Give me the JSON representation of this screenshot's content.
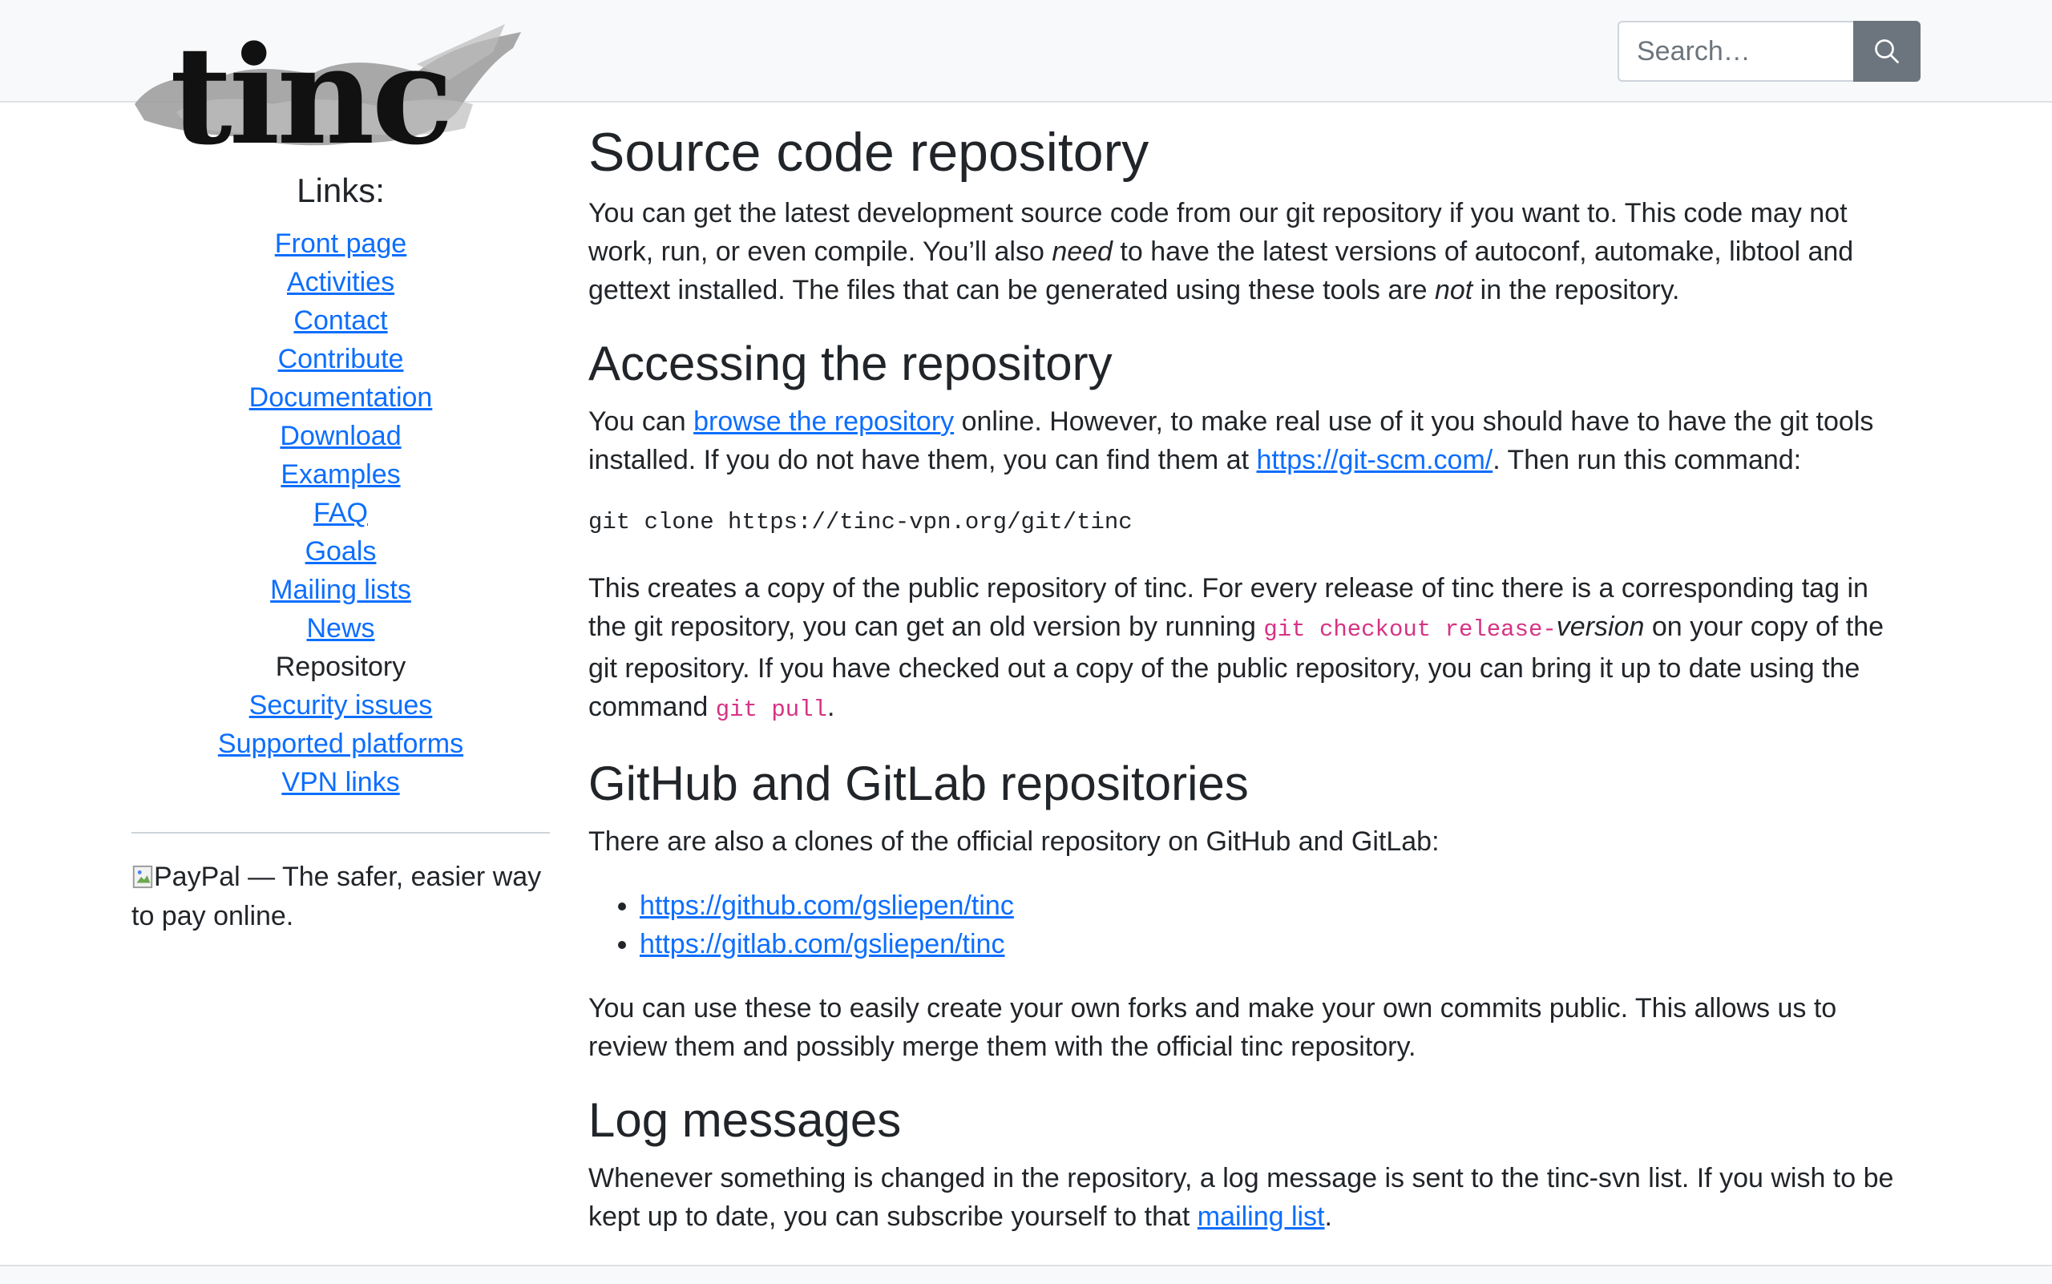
{
  "header": {
    "search_placeholder": "Search…"
  },
  "logo": {
    "text": "tinc"
  },
  "sidebar": {
    "heading": "Links:",
    "items": [
      {
        "label": "Front page",
        "link": true
      },
      {
        "label": "Activities",
        "link": true
      },
      {
        "label": "Contact",
        "link": true
      },
      {
        "label": "Contribute",
        "link": true
      },
      {
        "label": "Documentation",
        "link": true
      },
      {
        "label": "Download",
        "link": true
      },
      {
        "label": "Examples",
        "link": true
      },
      {
        "label": "FAQ",
        "link": true
      },
      {
        "label": "Goals",
        "link": true
      },
      {
        "label": "Mailing lists",
        "link": true
      },
      {
        "label": "News",
        "link": true
      },
      {
        "label": "Repository",
        "link": false
      },
      {
        "label": "Security issues",
        "link": true
      },
      {
        "label": "Supported platforms",
        "link": true
      },
      {
        "label": "VPN links",
        "link": true
      }
    ],
    "paypal_alt": "PayPal — The safer, easier way to pay online."
  },
  "main": {
    "title": "Source code repository",
    "intro": {
      "part1": "You can get the latest development source code from our git repository if you want to. This code may not work, run, or even compile. You’ll also ",
      "em1": "need",
      "part2": " to have the latest versions of autoconf, automake, libtool and gettext installed. The files that can be generated using these tools are ",
      "em2": "not",
      "part3": " in the repository."
    },
    "accessing": {
      "heading": "Accessing the repository",
      "p1_part1": "You can ",
      "p1_link1": "browse the repository",
      "p1_part2": " online. However, to make real use of it you should have to have the git tools installed. If you do not have them, you can find them at ",
      "p1_link2": "https://git-scm.com/",
      "p1_part3": ". Then run this command:",
      "command": "git clone https://tinc-vpn.org/git/tinc",
      "p2_part1": "This creates a copy of the public repository of tinc. For every release of tinc there is a corresponding tag in the git repository, you can get an old version by running ",
      "p2_code1": "git checkout release-",
      "p2_em": "version",
      "p2_part2": " on your copy of the git repository. If you have checked out a copy of the public repository, you can bring it up to date using the command ",
      "p2_code2": "git pull",
      "p2_part3": "."
    },
    "mirrors": {
      "heading": "GitHub and GitLab repositories",
      "intro": "There are also a clones of the official repository on GitHub and GitLab:",
      "links": [
        "https://github.com/gsliepen/tinc",
        "https://gitlab.com/gsliepen/tinc"
      ],
      "outro": "You can use these to easily create your own forks and make your own commits public. This allows us to review them and possibly merge them with the official tinc repository."
    },
    "log": {
      "heading": "Log messages",
      "part1": "Whenever something is changed in the repository, a log message is sent to the tinc-svn list. If you wish to be kept up to date, you can subscribe yourself to that ",
      "link": "mailing list",
      "part2": "."
    }
  }
}
